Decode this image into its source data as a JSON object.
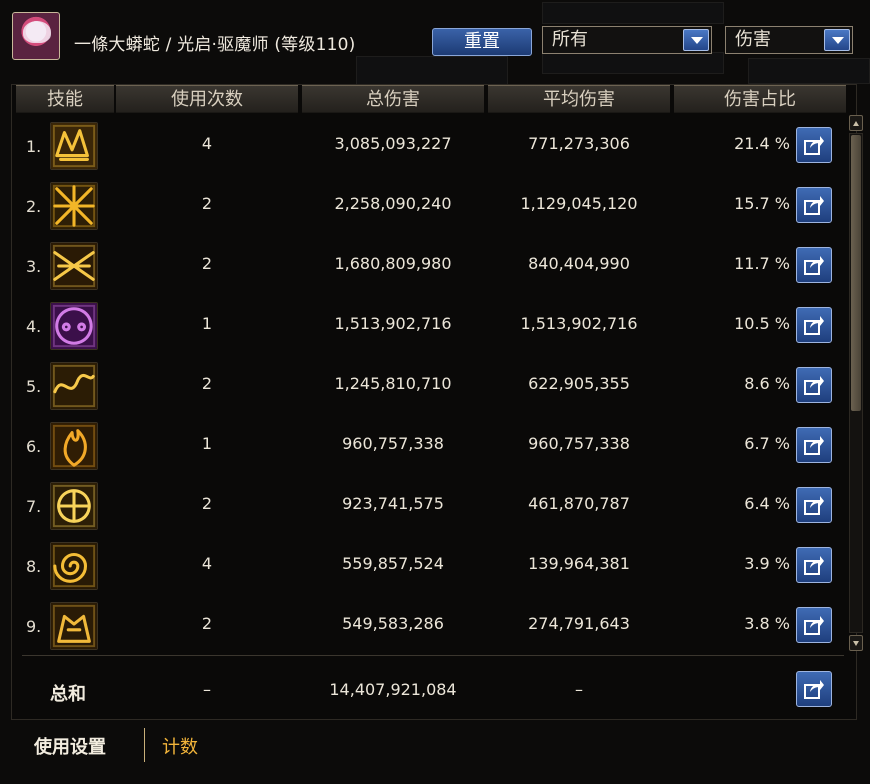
{
  "header": {
    "character_name": "一條大蟒蛇 / 光启·驱魔师 (等级110)",
    "reset_label": "重置",
    "filter_scope": "所有",
    "filter_metric": "伤害"
  },
  "table": {
    "columns": [
      "技能",
      "使用次数",
      "总伤害",
      "平均伤害",
      "伤害占比"
    ],
    "rows": [
      {
        "rank": "1.",
        "uses": "4",
        "total": "3,085,093,227",
        "average": "771,273,306",
        "share": "21.4 %",
        "icon": "gold-dragon-skill-icon"
      },
      {
        "rank": "2.",
        "uses": "2",
        "total": "2,258,090,240",
        "average": "1,129,045,120",
        "share": "15.7 %",
        "icon": "gold-lattice-skill-icon"
      },
      {
        "rank": "3.",
        "uses": "2",
        "total": "1,680,809,980",
        "average": "840,404,990",
        "share": "11.7 %",
        "icon": "gold-weapon-skill-icon"
      },
      {
        "rank": "4.",
        "uses": "1",
        "total": "1,513,902,716",
        "average": "1,513,902,716",
        "share": "10.5 %",
        "icon": "purple-summon-skill-icon"
      },
      {
        "rank": "5.",
        "uses": "2",
        "total": "1,245,810,710",
        "average": "622,905,355",
        "share": "8.6 %",
        "icon": "gold-wave-skill-icon"
      },
      {
        "rank": "6.",
        "uses": "1",
        "total": "960,757,338",
        "average": "960,757,338",
        "share": "6.7 %",
        "icon": "gold-flame-skill-icon"
      },
      {
        "rank": "7.",
        "uses": "2",
        "total": "923,741,575",
        "average": "461,870,787",
        "share": "6.4 %",
        "icon": "gold-orb-skill-icon"
      },
      {
        "rank": "8.",
        "uses": "4",
        "total": "559,857,524",
        "average": "139,964,381",
        "share": "3.9 %",
        "icon": "gold-spiral-skill-icon"
      },
      {
        "rank": "9.",
        "uses": "2",
        "total": "549,583,286",
        "average": "274,791,643",
        "share": "3.8 %",
        "icon": "gold-beast-skill-icon"
      }
    ],
    "summary": {
      "label": "总和",
      "uses": "–",
      "total": "14,407,921,084",
      "average": "–"
    }
  },
  "footer": {
    "tab_use_settings": "使用设置",
    "tab_count": "计数"
  },
  "colors": {
    "accent_blue": "#2f56a0",
    "tab_active_gold": "#f2b43a",
    "icon_gold": "#f5c23a",
    "icon_purple": "#a23fb8"
  }
}
